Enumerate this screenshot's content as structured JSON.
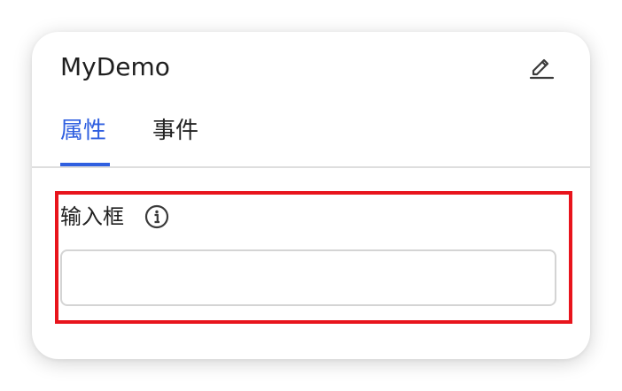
{
  "panel": {
    "title": "MyDemo",
    "edit_icon": "pencil-edit-icon"
  },
  "tabs": [
    {
      "label": "属性",
      "active": true
    },
    {
      "label": "事件",
      "active": false
    }
  ],
  "field": {
    "label": "输入框",
    "info_icon": "info-circle-icon",
    "value": "",
    "placeholder": ""
  },
  "colors": {
    "accent": "#2f5fe0",
    "highlight": "#e8141c",
    "text": "#1f1f1f"
  }
}
